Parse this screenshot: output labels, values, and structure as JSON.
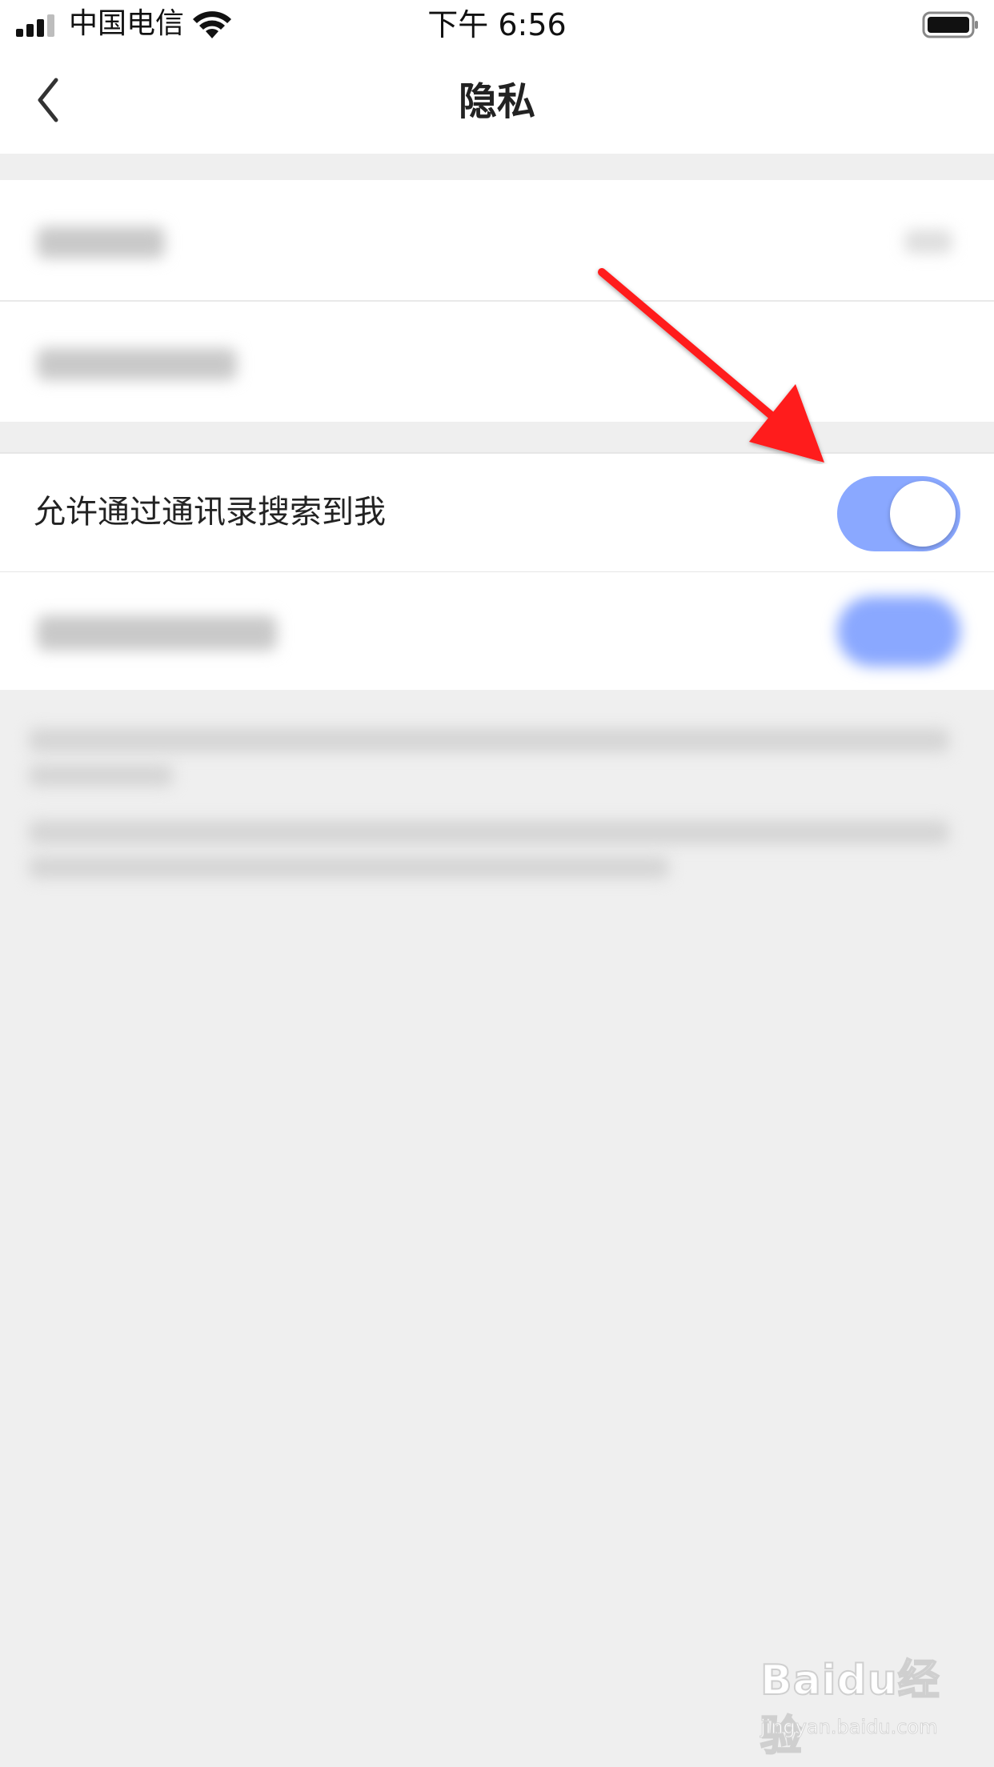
{
  "status_bar": {
    "carrier": "中国电信",
    "time": "下午 6:56"
  },
  "nav": {
    "title": "隐私",
    "back_icon": "chevron-left-icon"
  },
  "settings": {
    "contacts_search_label": "允许通过通讯录搜索到我",
    "contacts_search_enabled": true
  },
  "colors": {
    "toggle_on": "#8aa8ff",
    "background": "#efefef",
    "annotation_arrow": "#ff1a1a"
  },
  "watermark": {
    "brand": "Baidu经验",
    "url": "jingyan.baidu.com"
  }
}
